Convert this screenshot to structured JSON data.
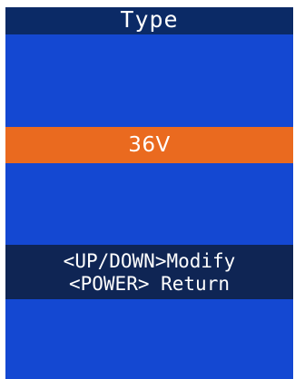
{
  "screen": {
    "title": "Type",
    "selected_value": "36V",
    "help": {
      "modify_hint": "<UP/DOWN>Modify",
      "return_hint": "<POWER> Return"
    }
  },
  "colors": {
    "background": "#1448d2",
    "title_bar": "#0b2a66",
    "highlight": "#ea6a1f",
    "help_box": "#0f2554",
    "text": "#ffffff"
  }
}
